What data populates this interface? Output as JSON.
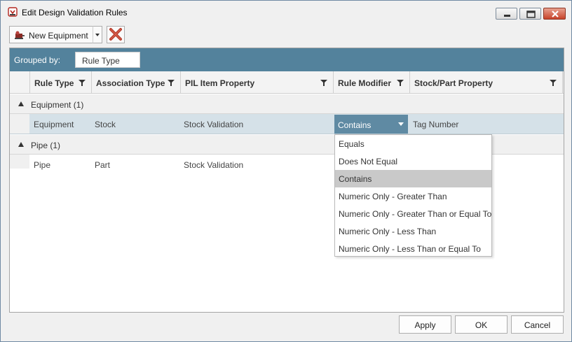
{
  "window": {
    "title": "Edit Design Validation Rules",
    "icon": "app-icon",
    "controls": [
      "minimize-icon",
      "maximize-icon",
      "close-icon"
    ]
  },
  "toolbar": {
    "new_label": "New Equipment",
    "new_icon": "equipment-icon",
    "dropdown_icon": "chevron-down-icon",
    "delete_icon": "delete-x-icon"
  },
  "grouping": {
    "label": "Grouped by:",
    "chip": "Rule Type"
  },
  "columns": [
    {
      "label": "Rule Type"
    },
    {
      "label": "Association Type"
    },
    {
      "label": "PIL Item Property"
    },
    {
      "label": "Rule Modifier"
    },
    {
      "label": "Stock/Part Property"
    }
  ],
  "groups": [
    {
      "label": "Equipment (1)",
      "rows": [
        {
          "rule_type": "Equipment",
          "association_type": "Stock",
          "pil_item_property": "Stock Validation",
          "rule_modifier": "Contains",
          "stock_part_property": "Tag Number"
        }
      ]
    },
    {
      "label": "Pipe (1)",
      "rows": [
        {
          "rule_type": "Pipe",
          "association_type": "Part",
          "pil_item_property": "Stock Validation",
          "rule_modifier": "",
          "stock_part_property": ""
        }
      ]
    }
  ],
  "modifier_options": [
    "Equals",
    "Does Not Equal",
    "Contains",
    "Numeric Only - Greater Than",
    "Numeric Only - Greater Than or Equal To",
    "Numeric Only - Less Than",
    "Numeric Only - Less Than or Equal To"
  ],
  "selected_modifier": "Contains",
  "buttons": {
    "apply": "Apply",
    "ok": "OK",
    "cancel": "Cancel"
  },
  "colors": {
    "group_bar": "#53829c",
    "selected_row": "#d5e1e8",
    "combo": "#5f8aa3",
    "highlight_option": "#c9c9c9"
  }
}
